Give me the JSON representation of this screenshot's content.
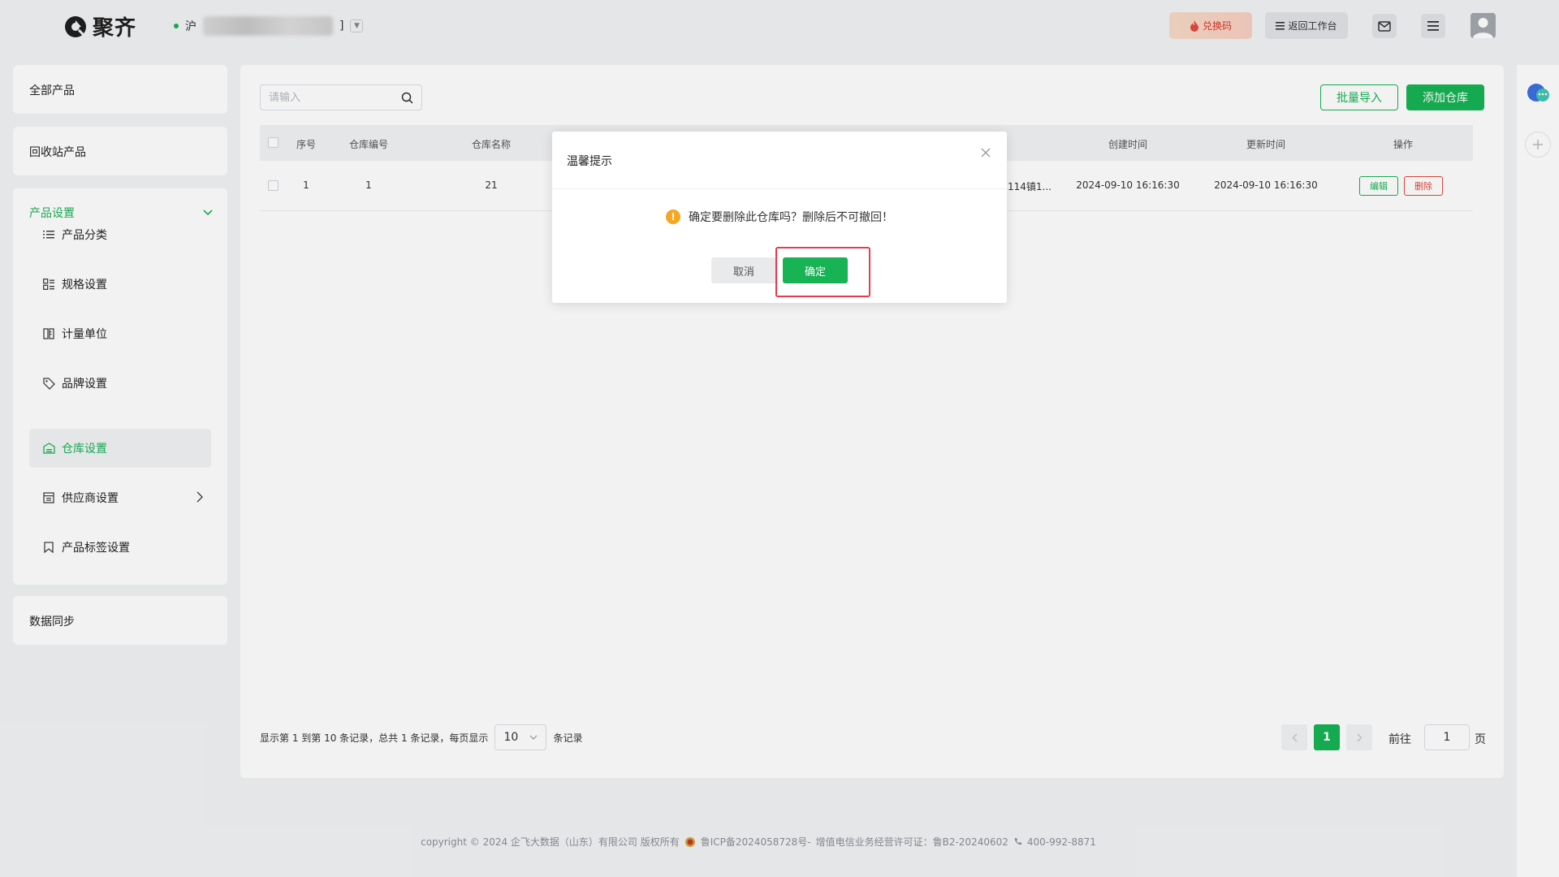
{
  "header": {
    "logo_text": "聚齐",
    "store_prefix": "沪",
    "store_suffix": "]",
    "redeem_label": "兑换码",
    "workbench_label": "返回工作台"
  },
  "sidebar": {
    "all_products": "全部产品",
    "recycle_products": "回收站产品",
    "product_settings": {
      "label": "产品设置",
      "items": [
        {
          "label": "产品分类",
          "icon": "list-icon"
        },
        {
          "label": "规格设置",
          "icon": "spec-icon"
        },
        {
          "label": "计量单位",
          "icon": "ruler-icon"
        },
        {
          "label": "品牌设置",
          "icon": "tag-icon"
        },
        {
          "label": "仓库设置",
          "icon": "warehouse-icon",
          "active": true
        },
        {
          "label": "供应商设置",
          "icon": "supplier-icon"
        },
        {
          "label": "产品标签设置",
          "icon": "bookmark-icon"
        }
      ]
    },
    "data_sync": "数据同步"
  },
  "main": {
    "search_placeholder": "请输入",
    "batch_import_label": "批量导入",
    "add_warehouse_label": "添加仓库",
    "table": {
      "columns": [
        "序号",
        "仓库编号",
        "仓库名称",
        "创建时间",
        "更新时间",
        "操作"
      ],
      "rows": [
        {
          "index": "1",
          "code": "1",
          "name": "21",
          "address": "114镇1...",
          "created": "2024-09-10 16:16:30",
          "updated": "2024-09-10 16:16:30"
        }
      ],
      "edit_label": "编辑",
      "delete_label": "删除"
    },
    "pagination": {
      "summary": "显示第 1 到第 10 条记录，总共 1 条记录，每页显示",
      "page_size": "10",
      "records_suffix": "条记录",
      "current_page": "1",
      "goto_label": "前往",
      "goto_value": "1",
      "page_suffix": "页"
    }
  },
  "footer": {
    "copyright": "copyright © 2024 企飞大数据（山东）有限公司 版权所有",
    "icp": "鲁ICP备2024058728号-",
    "license": "增值电信业务经营许可证：鲁B2-20240602",
    "phone": "400-992-8871"
  },
  "modal": {
    "title": "温馨提示",
    "message": "确定要删除此仓库吗？删除后不可撤回！",
    "cancel_label": "取消",
    "confirm_label": "确定"
  },
  "colors": {
    "primary": "#17b355",
    "danger": "#e5483f",
    "warning": "#f5a623",
    "highlight": "#e63b4f"
  }
}
